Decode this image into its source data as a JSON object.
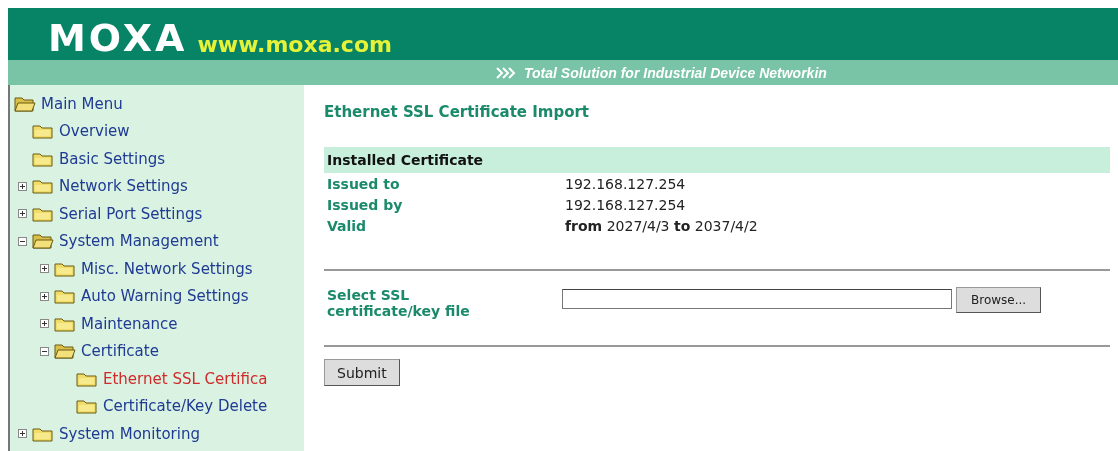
{
  "header": {
    "logo": "MOXA",
    "website": "www.moxa.com",
    "tagline": "Total Solution for Industrial Device Networkin"
  },
  "sidebar": {
    "tree": [
      {
        "label": "Main Menu",
        "expanded": true,
        "selected": false,
        "children": [
          {
            "label": "Overview",
            "selected": false
          },
          {
            "label": "Basic Settings",
            "selected": false
          },
          {
            "label": "Network Settings",
            "expanded": false,
            "selected": false
          },
          {
            "label": "Serial Port Settings",
            "expanded": false,
            "selected": false
          },
          {
            "label": "System Management",
            "expanded": true,
            "selected": false,
            "children": [
              {
                "label": "Misc. Network Settings",
                "expanded": false,
                "selected": false
              },
              {
                "label": "Auto Warning Settings",
                "expanded": false,
                "selected": false
              },
              {
                "label": "Maintenance",
                "expanded": false,
                "selected": false
              },
              {
                "label": "Certificate",
                "expanded": true,
                "selected": false,
                "children": [
                  {
                    "label": "Ethernet SSL Certifica",
                    "selected": true
                  },
                  {
                    "label": "Certificate/Key Delete",
                    "selected": false
                  }
                ]
              }
            ]
          },
          {
            "label": "System Monitoring",
            "expanded": false,
            "selected": false
          }
        ]
      }
    ]
  },
  "content": {
    "title": "Ethernet SSL Certificate Import",
    "section": "Installed Certificate",
    "rows": [
      {
        "label": "Issued to",
        "value": "192.168.127.254"
      },
      {
        "label": "Issued by",
        "value": "192.168.127.254"
      },
      {
        "label": "Valid",
        "value": "**from** 2027/4/3 **to** 2037/4/2"
      }
    ],
    "file_label": "Select SSL certificate/key file",
    "browse_button": "Browse...",
    "submit_button": "Submit"
  }
}
